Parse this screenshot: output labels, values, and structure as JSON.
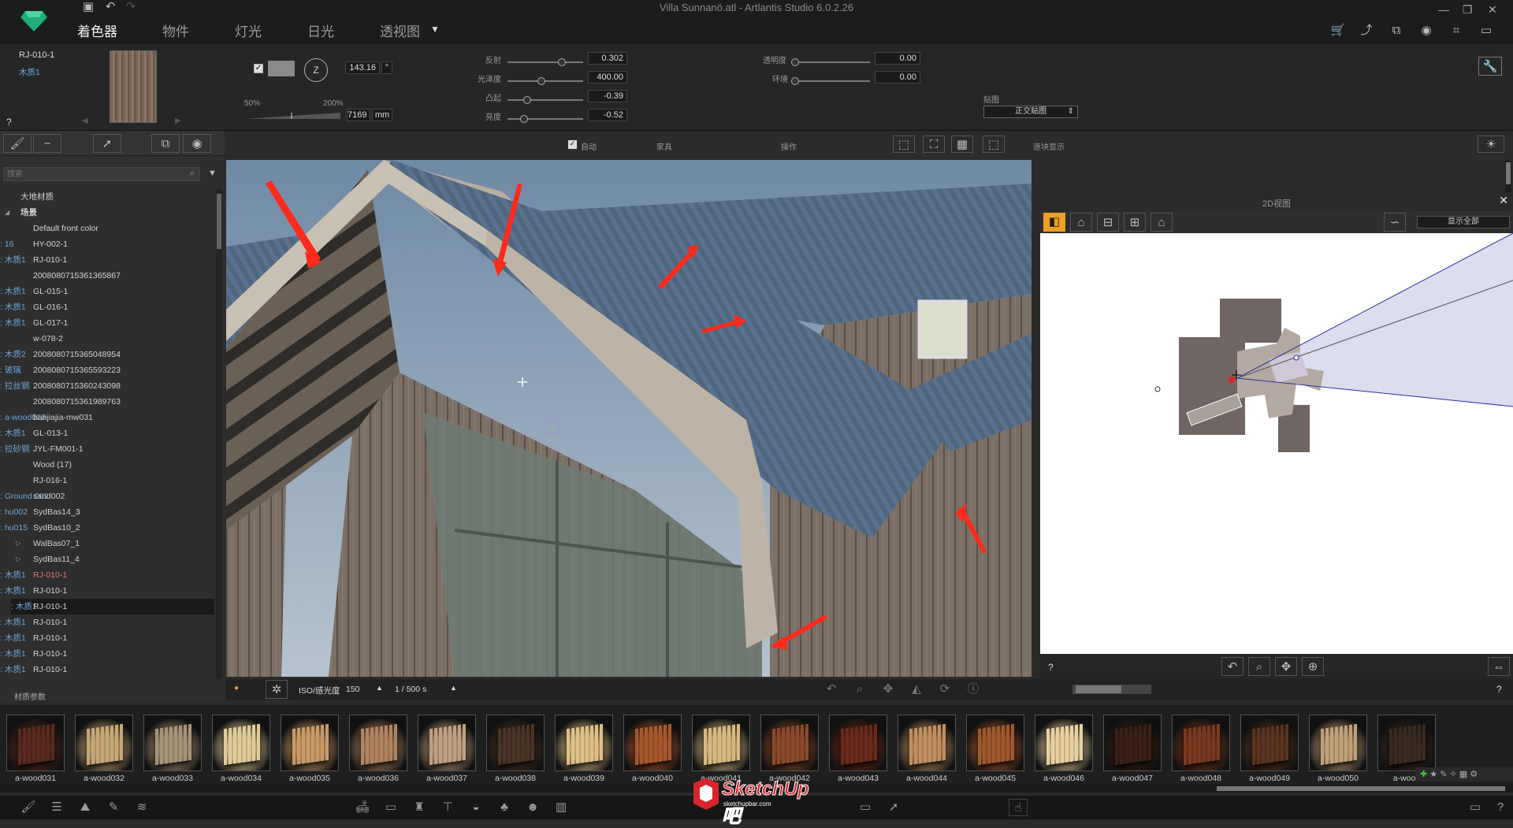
{
  "window": {
    "title": "Villa Sunnanö.atl - Artlantis Studio 6.0.2.26"
  },
  "tabs": [
    {
      "label": "着色器",
      "active": true
    },
    {
      "label": "物件",
      "active": false
    },
    {
      "label": "灯光",
      "active": false
    },
    {
      "label": "日光",
      "active": false
    },
    {
      "label": "透视图",
      "active": false
    }
  ],
  "material": {
    "name": "RJ-010-1",
    "sub": "木质1",
    "help": "?"
  },
  "texture": {
    "checked": true,
    "value": "143.16",
    "unit": "°",
    "size_value": "7169",
    "size_unit": "mm",
    "scale_min": "50%",
    "scale_max": "200%"
  },
  "params": [
    {
      "label": "反射",
      "value": "0.302"
    },
    {
      "label": "光泽度",
      "value": "400.00"
    },
    {
      "label": "凸起",
      "value": "-0.39"
    },
    {
      "label": "亮度",
      "value": "-0.52"
    }
  ],
  "params2": [
    {
      "label": "透明度",
      "value": "0.00"
    },
    {
      "label": "环境",
      "value": "0.00"
    }
  ],
  "mapping": {
    "label": "贴图",
    "value": "正交贴图"
  },
  "vp_toolbar": {
    "auto_label": "自动",
    "layer_label": "家具",
    "op_label": "操作",
    "display_label": "逐块显示"
  },
  "search": {
    "placeholder": "搜索"
  },
  "tree": [
    {
      "name": "大地材质",
      "mat": ""
    },
    {
      "name": "场景",
      "mat": ""
    },
    {
      "name": "Default front color",
      "mat": ""
    },
    {
      "name": "HY-002-1",
      "mat": "16"
    },
    {
      "name": "RJ-010-1",
      "mat": "木质1"
    },
    {
      "name": "2008080715361365867",
      "mat": ""
    },
    {
      "name": "GL-015-1",
      "mat": "木质1"
    },
    {
      "name": "GL-016-1",
      "mat": "木质1"
    },
    {
      "name": "GL-017-1",
      "mat": "木质1"
    },
    {
      "name": "w-078-2",
      "mat": ""
    },
    {
      "name": "2008080715365048954",
      "mat": "木质2"
    },
    {
      "name": "2008080715365593223",
      "mat": "玻璃"
    },
    {
      "name": "2008080715360243098",
      "mat": "拉丝钢"
    },
    {
      "name": "2008080715361989763",
      "mat": ""
    },
    {
      "name": "banjiajia-mw031",
      "mat": "a-wood013"
    },
    {
      "name": "GL-013-1",
      "mat": "木质1"
    },
    {
      "name": "JYL-FM001-1",
      "mat": "拉砂钢"
    },
    {
      "name": "Wood (17)",
      "mat": ""
    },
    {
      "name": "RJ-016-1",
      "mat": ""
    },
    {
      "name": "sand002",
      "mat": "Ground 002"
    },
    {
      "name": "SydBas14_3",
      "mat": "hu002"
    },
    {
      "name": "SydBas10_2",
      "mat": "hu015"
    },
    {
      "name": "WalBas07_1",
      "mat": ""
    },
    {
      "name": "SydBas11_4",
      "mat": ""
    },
    {
      "name": "RJ-010-1",
      "mat": "木质1"
    },
    {
      "name": "RJ-010-1",
      "mat": "木质1"
    },
    {
      "name": "RJ-010-1",
      "mat": "木质1"
    },
    {
      "name": "RJ-010-1",
      "mat": "木质1"
    },
    {
      "name": "RJ-010-1",
      "mat": "木质1"
    },
    {
      "name": "RJ-010-1",
      "mat": "木质1"
    },
    {
      "name": "RJ-010-1",
      "mat": "木质1"
    }
  ],
  "left_footer": "材质参数",
  "panel2d": {
    "title": "2D视图",
    "display": "显示全部",
    "help": "?"
  },
  "status": {
    "iso_label": "ISO/感光度",
    "iso_value": "150",
    "shutter": "1 / 500 s",
    "help": "?"
  },
  "library": [
    "a-wood031",
    "a-wood032",
    "a-wood033",
    "a-wood034",
    "a-wood035",
    "a-wood036",
    "a-wood037",
    "a-wood038",
    "a-wood039",
    "a-wood040",
    "a-wood041",
    "a-wood042",
    "a-wood043",
    "a-wood044",
    "a-wood045",
    "a-wood046",
    "a-wood047",
    "a-wood048",
    "a-wood049",
    "a-wood050",
    "a-wood"
  ],
  "watermark": {
    "text": "SketchUp吧",
    "url": "sketchupbar.com"
  },
  "colors": {
    "accent": "#f0a020",
    "bg": "#2b2b2b",
    "selected": "#1a1a1a",
    "mat_link": "#6fa4d8"
  }
}
